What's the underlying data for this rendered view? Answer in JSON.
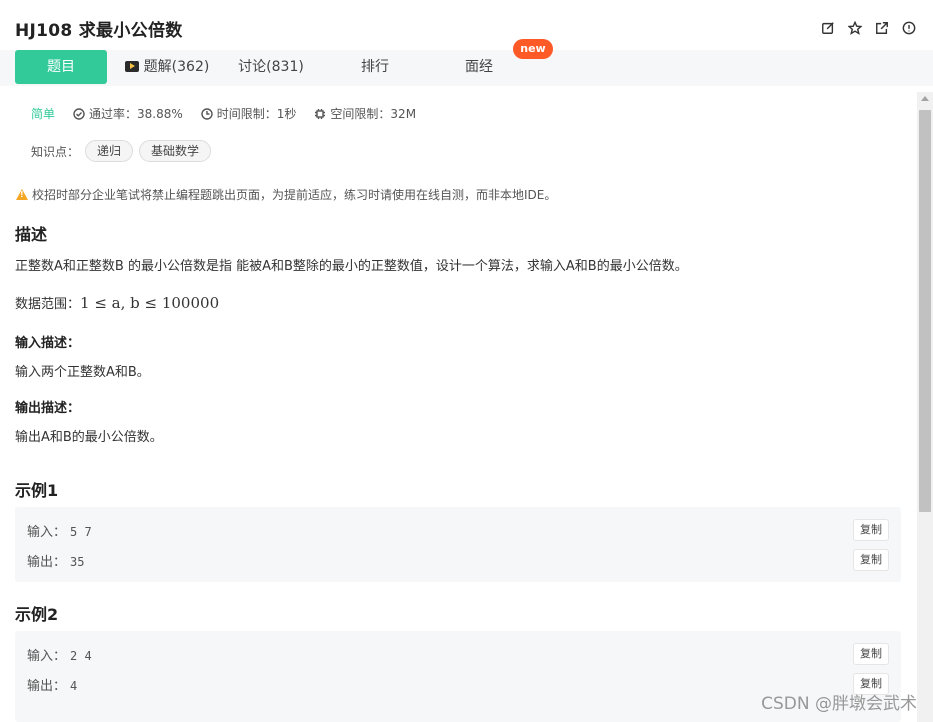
{
  "header": {
    "title": "HJ108  求最小公倍数",
    "icons": [
      "edit-icon",
      "star-icon",
      "share-icon",
      "info-icon"
    ]
  },
  "tabs": [
    {
      "label": "题目",
      "active": true
    },
    {
      "label": "题解(362)",
      "icon": "video-icon"
    },
    {
      "label": "讨论(831)"
    },
    {
      "label": "排行"
    },
    {
      "label": "面经"
    }
  ],
  "badge": {
    "label": "new",
    "color": "#fe5a27"
  },
  "meta": {
    "difficulty": "简单",
    "pass_rate": "通过率：38.88%",
    "time_limit": "时间限制：1秒",
    "space_limit": "空间限制：32M"
  },
  "knowledge": {
    "label": "知识点：",
    "tags": [
      "递归",
      "基础数学"
    ]
  },
  "notice": "校招时部分企业笔试将禁止编程题跳出页面，为提前适应，练习时请使用在线自测，而非本地IDE。",
  "description": {
    "heading": "描述",
    "text": "正整数A和正整数B 的最小公倍数是指 能被A和B整除的最小的正整数值，设计一个算法，求输入A和B的最小公倍数。",
    "range_label": "数据范围：",
    "range_expr": "1 ≤ a, b ≤ 100000"
  },
  "input_desc": {
    "heading": "输入描述：",
    "text": "输入两个正整数A和B。"
  },
  "output_desc": {
    "heading": "输出描述：",
    "text": "输出A和B的最小公倍数。"
  },
  "examples": [
    {
      "heading": "示例1",
      "input_label": "输入：",
      "input": "5 7",
      "output_label": "输出：",
      "output": "35",
      "copy_label": "复制"
    },
    {
      "heading": "示例2",
      "input_label": "输入：",
      "input": "2 4",
      "output_label": "输出：",
      "output": "4",
      "copy_label": "复制"
    }
  ],
  "watermark": "CSDN @胖墩会武术",
  "colors": {
    "accent": "#32ca99",
    "badge": "#fe5a27",
    "warn": "#f5a623"
  }
}
